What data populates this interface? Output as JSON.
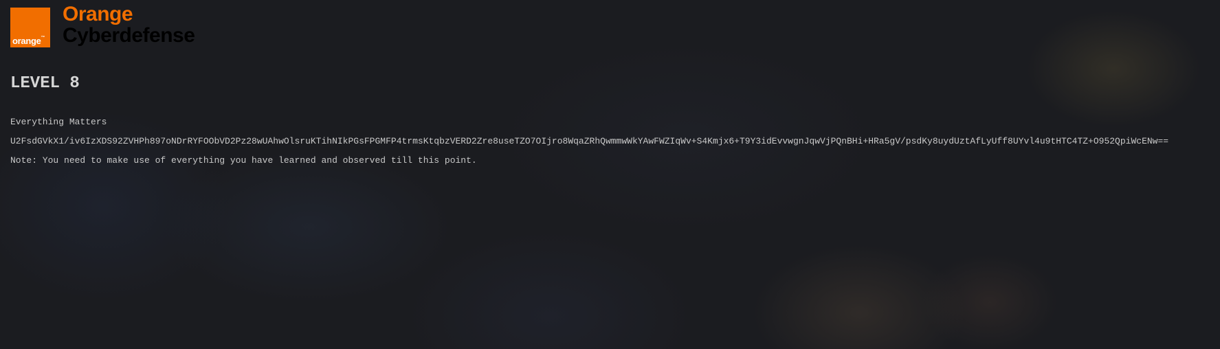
{
  "header": {
    "logo_text": "orange",
    "logo_tm": "™",
    "brand_line1": "Orange",
    "brand_line2": "Cyberdefense",
    "brand_color": "#f16e00"
  },
  "main": {
    "level_title": "LEVEL 8",
    "subtitle": "Everything Matters",
    "ciphertext": "U2FsdGVkX1/iv6IzXDS92ZVHPh897oNDrRYFOObVD2Pz28wUAhwOlsruKTihNIkPGsFPGMFP4trmsKtqbzVERD2Zre8useTZO7OIjro8WqaZRhQwmmwWkYAwFWZIqWv+S4Kmjx6+T9Y3idEvvwgnJqwVjPQnBHi+HRa5gV/psdKy8uydUztAfLyUff8UYvl4u9tHTC4TZ+O952QpiWcENw==",
    "note": "Note: You need to make use of everything you have learned and observed till this point."
  }
}
